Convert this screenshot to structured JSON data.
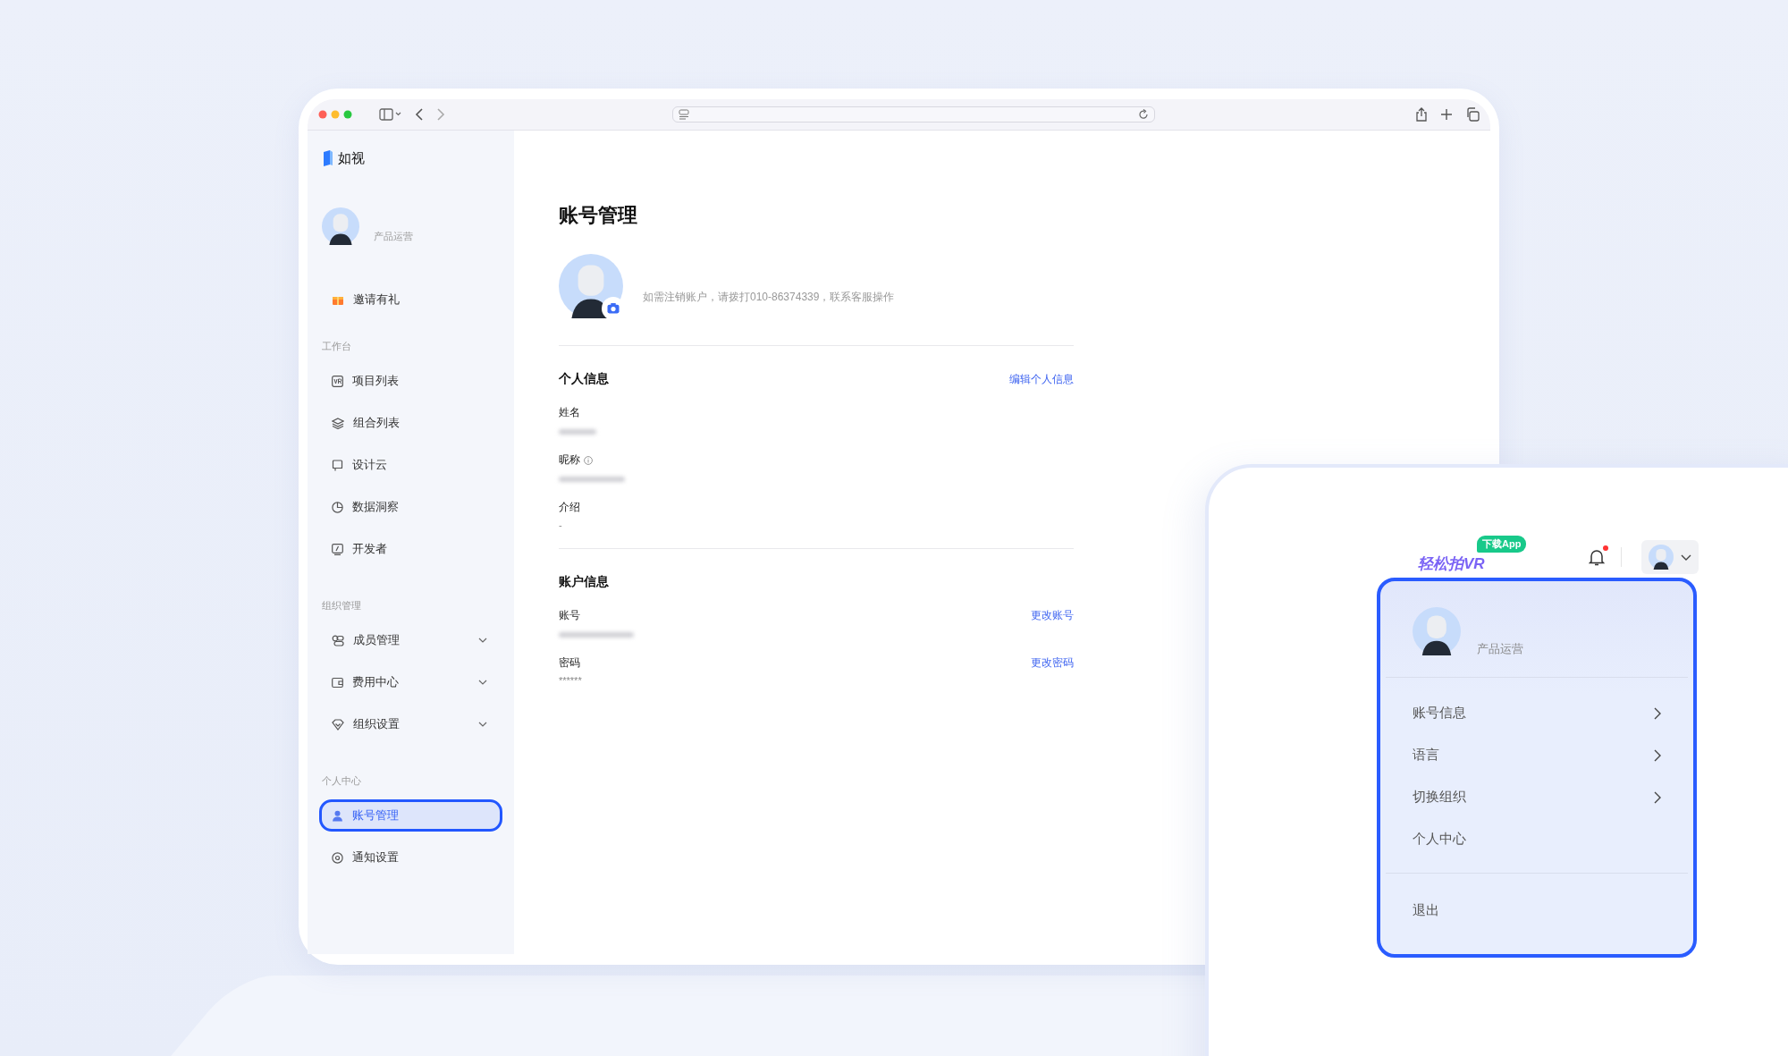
{
  "sidebar": {
    "logo": "如视",
    "profile": {
      "role": "产品运营"
    },
    "promo": {
      "label": "邀请有礼",
      "kind": "gift"
    },
    "sections": [
      {
        "title": "工作台",
        "items": [
          {
            "label": "项目列表",
            "kind": "vr",
            "expandable": false,
            "selected": false
          },
          {
            "label": "组合列表",
            "kind": "layers",
            "expandable": false,
            "selected": false
          },
          {
            "label": "设计云",
            "kind": "board",
            "expandable": false,
            "selected": false
          },
          {
            "label": "数据洞察",
            "kind": "pie",
            "expandable": false,
            "selected": false
          },
          {
            "label": "开发者",
            "kind": "terminal",
            "expandable": false,
            "selected": false
          }
        ]
      },
      {
        "title": "组织管理",
        "items": [
          {
            "label": "成员管理",
            "kind": "members",
            "expandable": true,
            "selected": false
          },
          {
            "label": "费用中心",
            "kind": "wallet",
            "expandable": true,
            "selected": false
          },
          {
            "label": "组织设置",
            "kind": "shield",
            "expandable": true,
            "selected": false
          }
        ]
      },
      {
        "title": "个人中心",
        "items": [
          {
            "label": "账号管理",
            "kind": "user",
            "expandable": false,
            "selected": true
          },
          {
            "label": "通知设置",
            "kind": "gear",
            "expandable": false,
            "selected": false
          }
        ]
      }
    ]
  },
  "main": {
    "title": "账号管理",
    "notice": "如需注销账户，请拨打010-86374339，联系客服操作",
    "sections": [
      {
        "title": "个人信息",
        "action": "编辑个人信息",
        "fields": [
          {
            "label": "姓名",
            "kind": "redacted",
            "info": false
          },
          {
            "label": "昵称",
            "kind": "redacted",
            "info": true
          },
          {
            "label": "介绍",
            "kind": "text",
            "value": "-",
            "info": false
          }
        ]
      },
      {
        "title": "账户信息",
        "fields": [
          {
            "label": "账号",
            "kind": "redacted",
            "info": false,
            "action": "更改账号"
          },
          {
            "label": "密码",
            "kind": "text",
            "value": "******",
            "info": false,
            "action": "更改密码"
          }
        ]
      }
    ]
  },
  "popup": {
    "brand": "轻松拍VR",
    "badge": "下载App",
    "unread": true,
    "menu": {
      "role": "产品运营",
      "items": [
        {
          "label": "账号信息",
          "submenu": true
        },
        {
          "label": "语言",
          "submenu": true
        },
        {
          "label": "切换组织",
          "submenu": true
        },
        {
          "label": "个人中心",
          "submenu": false
        }
      ],
      "footer": "退出"
    }
  }
}
